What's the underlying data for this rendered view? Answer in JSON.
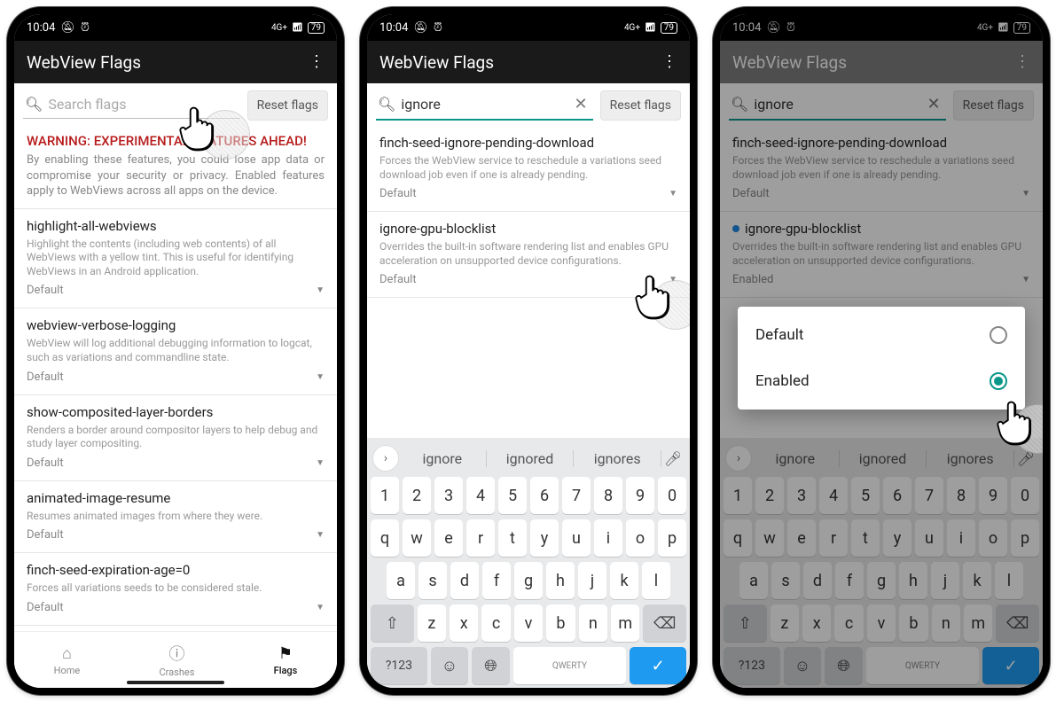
{
  "status": {
    "time": "10:04",
    "net_label": "4G+",
    "battery": "79"
  },
  "appbar": {
    "title": "WebView Flags"
  },
  "search": {
    "placeholder": "Search flags",
    "query": "ignore",
    "reset": "Reset flags"
  },
  "warning": {
    "title": "WARNING: EXPERIMENTAL FEATURES AHEAD!",
    "body": "By enabling these features, you could lose app data or compromise your security or privacy. Enabled features apply to WebViews across all apps on the device."
  },
  "flags_full": [
    {
      "name": "highlight-all-webviews",
      "desc": "Highlight the contents (including web contents) of all WebViews with a yellow tint. This is useful for identifying WebViews in an Android application.",
      "value": "Default"
    },
    {
      "name": "webview-verbose-logging",
      "desc": "WebView will log additional debugging information to logcat, such as variations and commandline state.",
      "value": "Default"
    },
    {
      "name": "show-composited-layer-borders",
      "desc": "Renders a border around compositor layers to help debug and study layer compositing.",
      "value": "Default"
    },
    {
      "name": "animated-image-resume",
      "desc": "Resumes animated images from where they were.",
      "value": "Default"
    },
    {
      "name": "finch-seed-expiration-age=0",
      "desc": "Forces all variations seeds to be considered stale.",
      "value": "Default"
    },
    {
      "name": "finch-seed-ignore-pending-download",
      "desc": "",
      "value": ""
    }
  ],
  "flags_filtered_default": [
    {
      "name": "finch-seed-ignore-pending-download",
      "desc": "Forces the WebView service to reschedule a variations seed download job even if one is already pending.",
      "value": "Default",
      "modified": false
    },
    {
      "name": "ignore-gpu-blocklist",
      "desc": "Overrides the built-in software rendering list and enables GPU acceleration on unsupported device configurations.",
      "value": "Default",
      "modified": false
    }
  ],
  "flags_filtered_enabled": [
    {
      "name": "finch-seed-ignore-pending-download",
      "desc": "Forces the WebView service to reschedule a variations seed download job even if one is already pending.",
      "value": "Default",
      "modified": false
    },
    {
      "name": "ignore-gpu-blocklist",
      "desc": "Overrides the built-in software rendering list and enables GPU acceleration on unsupported device configurations.",
      "value": "Enabled",
      "modified": true
    }
  ],
  "bottomnav": {
    "items": [
      {
        "label": "Home",
        "icon": "home"
      },
      {
        "label": "Crashes",
        "icon": "alert"
      },
      {
        "label": "Flags",
        "icon": "flag"
      }
    ],
    "active": 2
  },
  "keyboard": {
    "suggestions": [
      "ignore",
      "ignored",
      "ignores"
    ],
    "row1": [
      "1",
      "2",
      "3",
      "4",
      "5",
      "6",
      "7",
      "8",
      "9",
      "0"
    ],
    "row2": [
      "q",
      "w",
      "e",
      "r",
      "t",
      "y",
      "u",
      "i",
      "o",
      "p"
    ],
    "row3": [
      "a",
      "s",
      "d",
      "f",
      "g",
      "h",
      "j",
      "k",
      "l"
    ],
    "row4": [
      "z",
      "x",
      "c",
      "v",
      "b",
      "n",
      "m"
    ],
    "sym": "?123",
    "layout": "QWERTY"
  },
  "popup": {
    "options": [
      "Default",
      "Enabled"
    ],
    "selected": 1
  }
}
